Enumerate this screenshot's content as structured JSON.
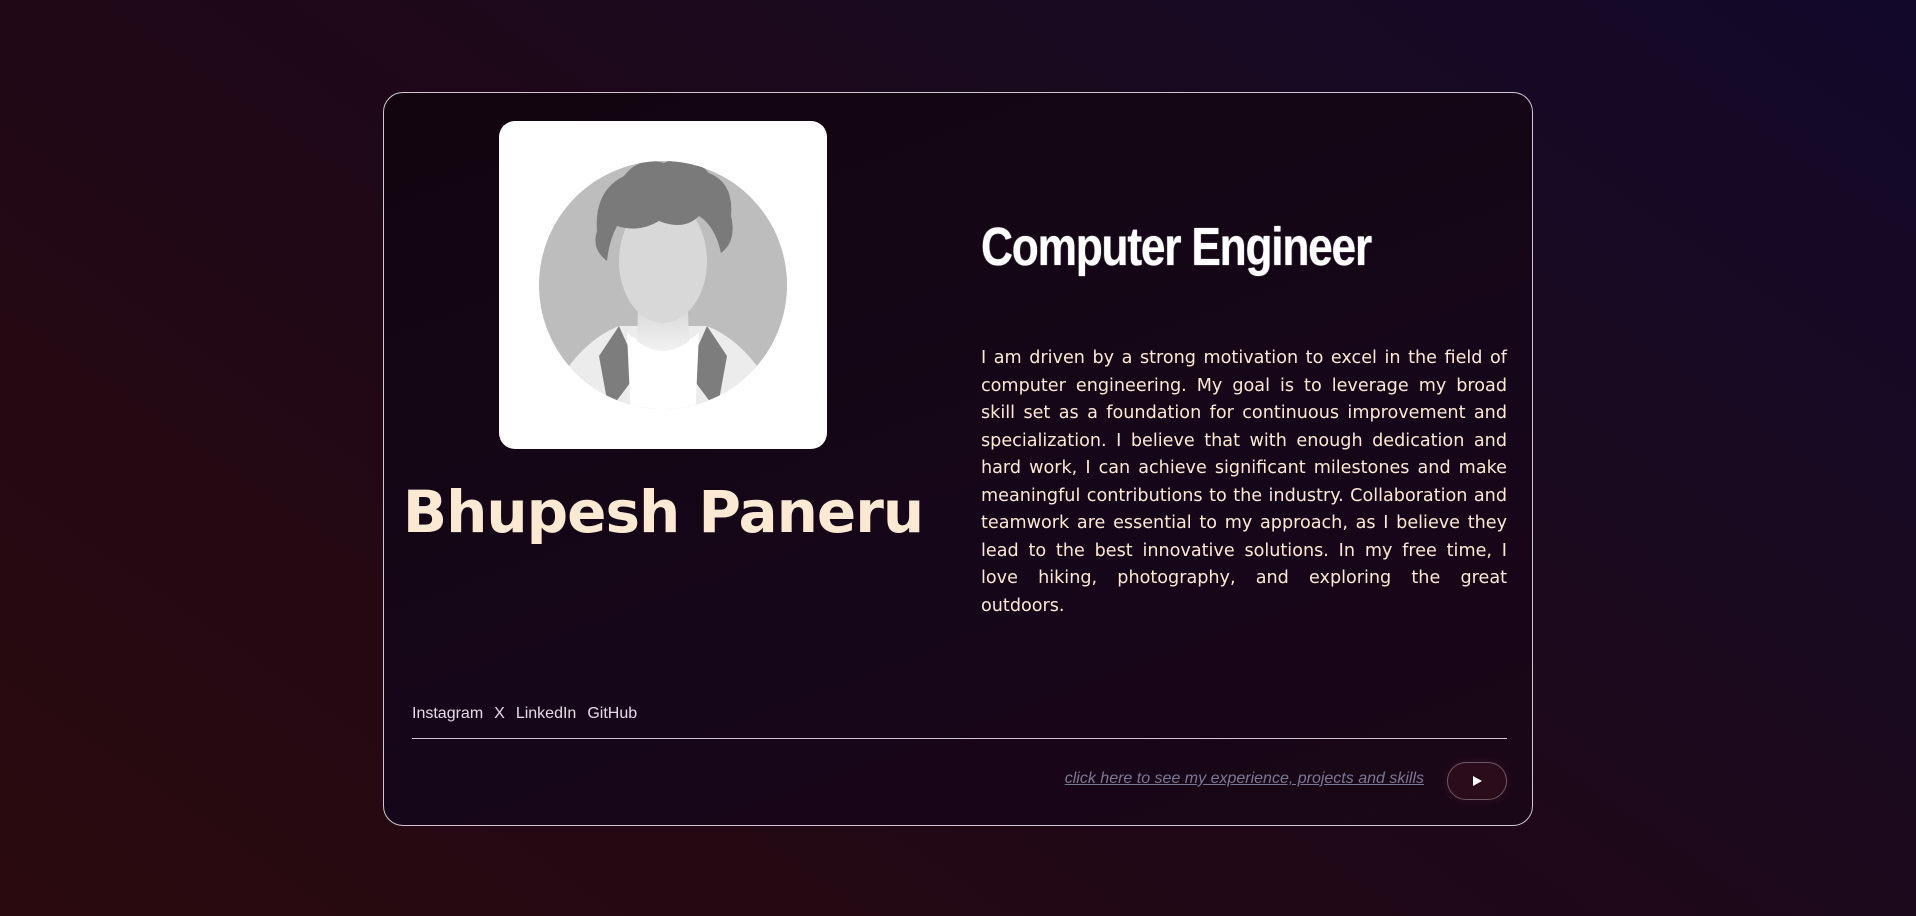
{
  "profile": {
    "name": "Bhupesh Paneru",
    "role": "Computer Engineer",
    "bio": "I am driven by a strong motivation to excel in the field of computer engineering. My goal is to leverage my broad skill set as a foundation for continuous improvement and specialization. I believe that with enough dedication and hard work, I can achieve significant milestones and make meaningful contributions to the industry. Collaboration and teamwork are essential to my approach, as I believe they lead to the best innovative solutions. In my free time, I love hiking, photography, and exploring the great outdoors.",
    "avatar_icon": "default-person-avatar"
  },
  "socials": [
    {
      "label": "Instagram"
    },
    {
      "label": "X"
    },
    {
      "label": "LinkedIn"
    },
    {
      "label": "GitHub"
    }
  ],
  "cta": {
    "link_text": "click here to see my experience, projects and skills",
    "button_icon": "play-icon"
  },
  "colors": {
    "name_text": "#fbe9d4",
    "card_border": "#cfc6d2",
    "link_text": "#7a7895"
  }
}
